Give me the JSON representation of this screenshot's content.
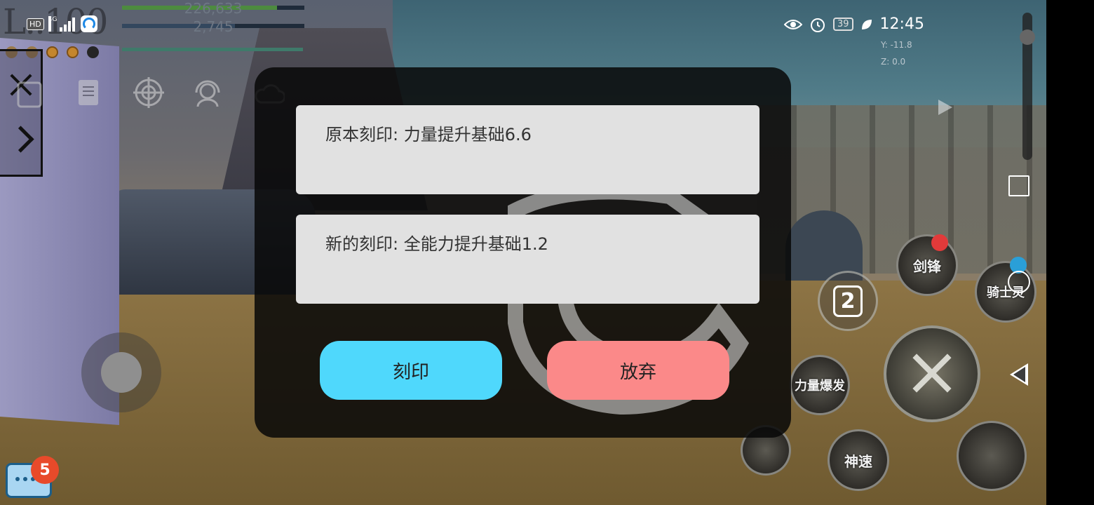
{
  "hud": {
    "level_text": "L..100",
    "hp_value": "226,633",
    "mp_value": "2,745",
    "hp_fill_fraction": 0.85,
    "mp_fill_fraction": 0.62,
    "net_label": "HD",
    "net_type": "4G",
    "colors": {
      "hp": "#4d8b3f",
      "mp": "#33475e",
      "exp": "#3f7a6a"
    }
  },
  "system_bar": {
    "battery": "39",
    "time": "12:45",
    "icons": [
      "eye-icon",
      "alarm-icon",
      "battery-icon",
      "leaf-icon"
    ]
  },
  "coordinates": {
    "y": "Y: -11.8",
    "z": "Z: 0.0"
  },
  "toolbar": {
    "icons": [
      "phone-icon",
      "scroll-icon",
      "target-icon",
      "support-headset-icon",
      "cloud-icon"
    ]
  },
  "dialog": {
    "original_label": "原本刻印: 力量提升基础6.6",
    "new_label": "新的刻印: 全能力提升基础1.2",
    "confirm_label": "刻印",
    "cancel_label": "放弃",
    "colors": {
      "confirm": "#4fd8fc",
      "cancel": "#fb8989",
      "box": "#e1e1e1"
    }
  },
  "skills": {
    "slot_number": "2",
    "skill_sword": "剑锋",
    "skill_knight": "骑士灵",
    "skill_burst": "力量爆发",
    "skill_speed": "神速"
  },
  "chat": {
    "unread_count": "5"
  }
}
